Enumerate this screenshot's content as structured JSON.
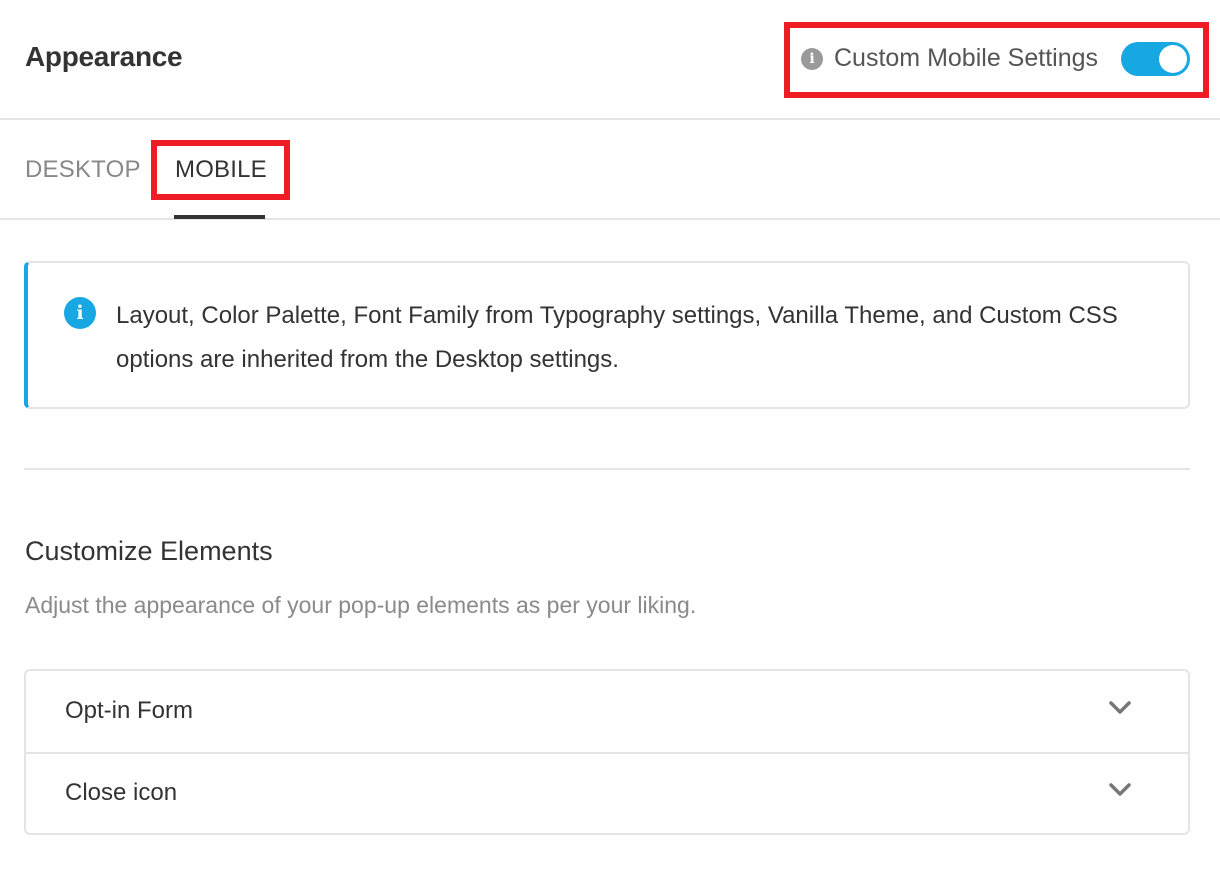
{
  "header": {
    "title": "Appearance",
    "custom_mobile_label": "Custom Mobile Settings",
    "info_icon": "info-icon",
    "toggle_state": "on"
  },
  "tabs": [
    {
      "label": "DESKTOP",
      "active": false
    },
    {
      "label": "MOBILE",
      "active": true
    }
  ],
  "notice": {
    "icon": "info-icon",
    "text": "Layout, Color Palette, Font Family from Typography settings, Vanilla Theme, and Custom CSS options are inherited from the Desktop settings."
  },
  "customize": {
    "title": "Customize Elements",
    "description": "Adjust the appearance of your pop-up elements as per your liking.",
    "items": [
      {
        "label": "Opt-in Form",
        "icon": "chevron-down-icon"
      },
      {
        "label": "Close icon",
        "icon": "chevron-down-icon"
      }
    ]
  },
  "colors": {
    "accent": "#17a8e3",
    "highlight_box": "#ee1c25",
    "border": "#e4e4e4"
  }
}
